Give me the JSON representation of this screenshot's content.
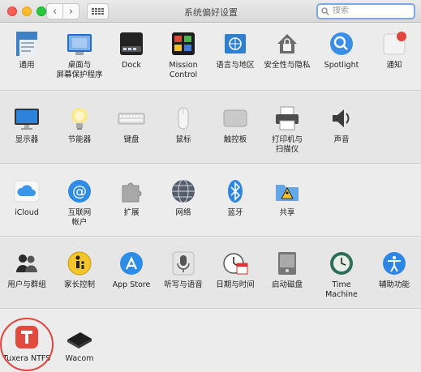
{
  "window": {
    "title": "系统偏好设置"
  },
  "search": {
    "placeholder": "搜索"
  },
  "rows": [
    [
      {
        "name": "general",
        "label": "通用",
        "icon": "file-icon"
      },
      {
        "name": "desktop",
        "label": "桌面与\n屏幕保护程序",
        "icon": "desktop-icon"
      },
      {
        "name": "dock",
        "label": "Dock",
        "icon": "dock-icon"
      },
      {
        "name": "mission-control",
        "label": "Mission\nControl",
        "icon": "mission-control-icon"
      },
      {
        "name": "language",
        "label": "语言与地区",
        "icon": "flag-icon"
      },
      {
        "name": "security",
        "label": "安全性与隐私",
        "icon": "house-lock-icon"
      },
      {
        "name": "spotlight",
        "label": "Spotlight",
        "icon": "magnifier-icon"
      },
      {
        "name": "notifications",
        "label": "通知",
        "icon": "notification-icon"
      }
    ],
    [
      {
        "name": "displays",
        "label": "显示器",
        "icon": "monitor-icon"
      },
      {
        "name": "energy",
        "label": "节能器",
        "icon": "bulb-icon"
      },
      {
        "name": "keyboard",
        "label": "键盘",
        "icon": "keyboard-icon"
      },
      {
        "name": "mouse",
        "label": "鼠标",
        "icon": "mouse-icon"
      },
      {
        "name": "trackpad",
        "label": "触控板",
        "icon": "trackpad-icon"
      },
      {
        "name": "printers",
        "label": "打印机与\n扫描仪",
        "icon": "printer-icon"
      },
      {
        "name": "sound",
        "label": "声音",
        "icon": "speaker-icon"
      }
    ],
    [
      {
        "name": "icloud",
        "label": "iCloud",
        "icon": "cloud-icon"
      },
      {
        "name": "internet-accounts",
        "label": "互联网\n帐户",
        "icon": "at-icon"
      },
      {
        "name": "extensions",
        "label": "扩展",
        "icon": "puzzle-icon"
      },
      {
        "name": "network",
        "label": "网络",
        "icon": "globe-icon"
      },
      {
        "name": "bluetooth",
        "label": "蓝牙",
        "icon": "bluetooth-icon"
      },
      {
        "name": "sharing",
        "label": "共享",
        "icon": "sharing-folder-icon"
      }
    ],
    [
      {
        "name": "users",
        "label": "用户与群组",
        "icon": "users-icon"
      },
      {
        "name": "parental",
        "label": "家长控制",
        "icon": "parental-icon"
      },
      {
        "name": "app-store",
        "label": "App Store",
        "icon": "app-store-icon"
      },
      {
        "name": "dictation",
        "label": "听写与语音",
        "icon": "microphone-icon"
      },
      {
        "name": "date-time",
        "label": "日期与时间",
        "icon": "clock-calendar-icon"
      },
      {
        "name": "startup-disk",
        "label": "启动磁盘",
        "icon": "disk-icon"
      },
      {
        "name": "time-machine",
        "label": "Time Machine",
        "icon": "time-machine-icon"
      },
      {
        "name": "accessibility",
        "label": "辅助功能",
        "icon": "accessibility-icon"
      }
    ],
    [
      {
        "name": "tuxera",
        "label": "Tuxera NTFS",
        "icon": "tuxera-icon"
      },
      {
        "name": "wacom",
        "label": "Wacom",
        "icon": "tablet-icon"
      }
    ]
  ]
}
